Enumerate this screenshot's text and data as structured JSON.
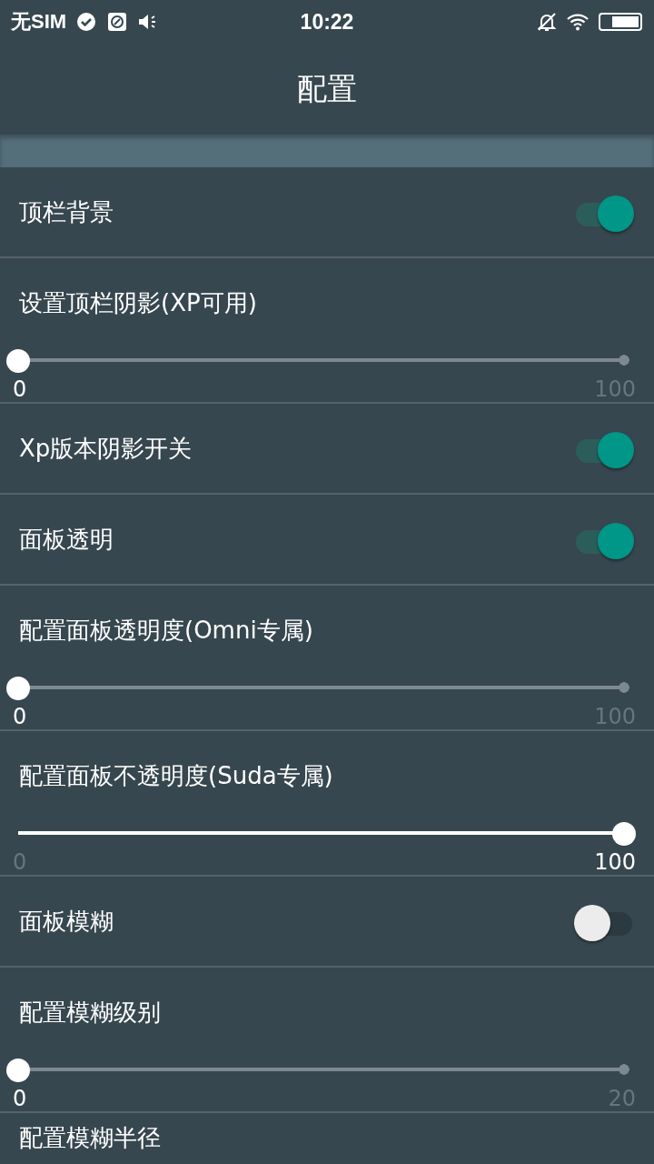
{
  "status_bar": {
    "carrier": "无SIM",
    "time": "10:22"
  },
  "app_bar": {
    "title": "配置"
  },
  "settings": [
    {
      "kind": "toggle",
      "label": "顶栏背景",
      "on": true
    },
    {
      "kind": "slider",
      "label": "设置顶栏阴影(XP可用)",
      "level": 0,
      "min": "0",
      "max": "100"
    },
    {
      "kind": "toggle",
      "label": "Xp版本阴影开关",
      "on": true
    },
    {
      "kind": "toggle",
      "label": "面板透明",
      "on": true
    },
    {
      "kind": "slider",
      "label": "配置面板透明度(Omni专属)",
      "level": 0,
      "min": "0",
      "max": "100"
    },
    {
      "kind": "slider",
      "label": "配置面板不透明度(Suda专属)",
      "level": 1,
      "min": "0",
      "max": "100"
    },
    {
      "kind": "toggle",
      "label": "面板模糊",
      "on": false
    },
    {
      "kind": "slider",
      "label": "配置模糊级别",
      "level": 0,
      "min": "0",
      "max": "20"
    },
    {
      "kind": "heading",
      "label": "配置模糊半径"
    }
  ]
}
